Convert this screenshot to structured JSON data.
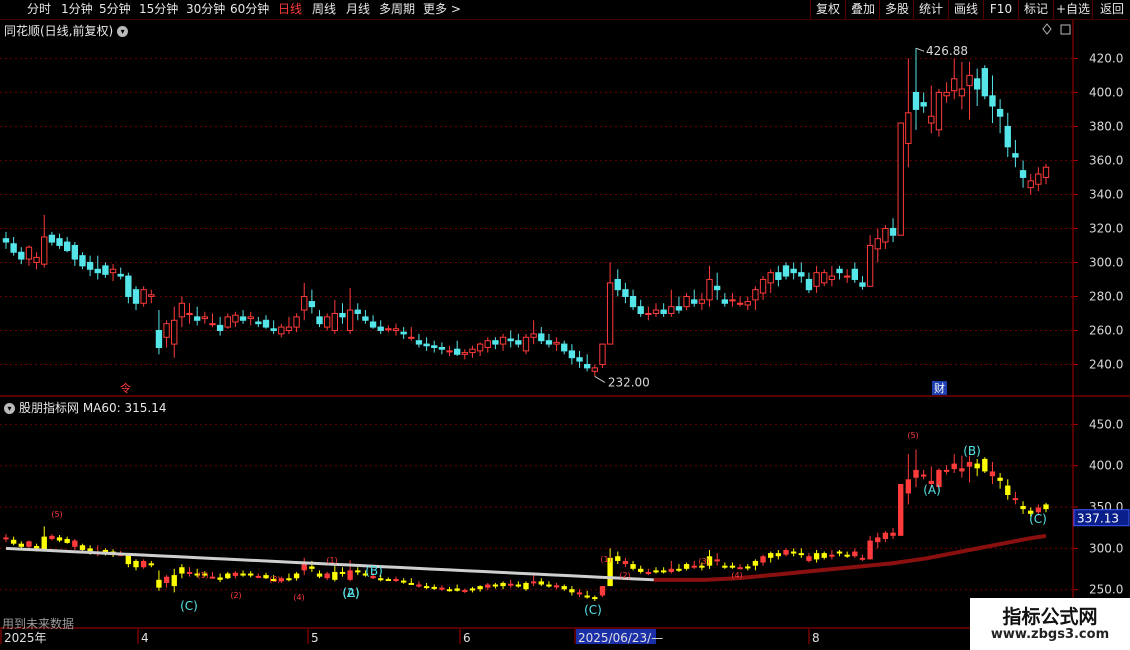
{
  "toolbar": {
    "periods": [
      "分时",
      "1分钟",
      "5分钟",
      "15分钟",
      "30分钟",
      "60分钟",
      "日线",
      "周线",
      "月线",
      "多周期",
      "更多 >"
    ],
    "active_period": "日线",
    "right_buttons": [
      "复权",
      "叠加",
      "多股",
      "统计",
      "画线",
      "F10",
      "标记",
      "+自选",
      "返回"
    ]
  },
  "main_panel": {
    "title": "同花顺(日线,前复权)",
    "high_label": "426.88",
    "low_label": "232.00",
    "marker_left": "令",
    "marker_right": "财"
  },
  "sub_panel": {
    "title": "股朋指标网 MA60: 315.14",
    "price_box": "337.13"
  },
  "future_note": "用到未来数据",
  "watermark": {
    "title": "指标公式网",
    "url": "www.zbgs3.com"
  },
  "colors": {
    "up": "#ff3b3b",
    "down": "#55e6ea",
    "yellow": "#ffff00",
    "grid": "#6b0000",
    "axis": "#b00000"
  },
  "chart_data": [
    {
      "type": "candlestick",
      "name": "main",
      "ylim": [
        225,
        432
      ],
      "yticks": [
        240,
        260,
        280,
        300,
        320,
        340,
        360,
        380,
        400,
        420
      ],
      "xlabels": [],
      "candles": [
        [
          314,
          318,
          308,
          312
        ],
        [
          311,
          315,
          304,
          306
        ],
        [
          306,
          309,
          299,
          302
        ],
        [
          302,
          310,
          298,
          309
        ],
        [
          300,
          306,
          296,
          303
        ],
        [
          299,
          328,
          297,
          315
        ],
        [
          316,
          318,
          310,
          312
        ],
        [
          314,
          317,
          308,
          310
        ],
        [
          312,
          315,
          306,
          307
        ],
        [
          310,
          312,
          298,
          302
        ],
        [
          304,
          306,
          296,
          298
        ],
        [
          300,
          304,
          292,
          296
        ],
        [
          296,
          304,
          290,
          294
        ],
        [
          298,
          300,
          291,
          293
        ],
        [
          294,
          299,
          289,
          296
        ],
        [
          293,
          297,
          290,
          292
        ],
        [
          292,
          294,
          276,
          280
        ],
        [
          284,
          286,
          272,
          276
        ],
        [
          276,
          286,
          274,
          284
        ],
        [
          280,
          284,
          276,
          281
        ],
        [
          260,
          272,
          246,
          250
        ],
        [
          256,
          266,
          250,
          264
        ],
        [
          252,
          274,
          244,
          266
        ],
        [
          268,
          280,
          262,
          276
        ],
        [
          270,
          276,
          264,
          270
        ],
        [
          268,
          274,
          263,
          266
        ],
        [
          267,
          271,
          264,
          268
        ],
        [
          264,
          270,
          262,
          264
        ],
        [
          263,
          268,
          257,
          260
        ],
        [
          262,
          270,
          261,
          268
        ],
        [
          265,
          271,
          262,
          269
        ],
        [
          268,
          272,
          264,
          266
        ],
        [
          267,
          271,
          263,
          268
        ],
        [
          265,
          268,
          262,
          264
        ],
        [
          266,
          269,
          261,
          262
        ],
        [
          261,
          266,
          258,
          260
        ],
        [
          258,
          264,
          256,
          262
        ],
        [
          260,
          268,
          258,
          262
        ],
        [
          262,
          270,
          259,
          268
        ],
        [
          272,
          288,
          266,
          280
        ],
        [
          277,
          284,
          270,
          274
        ],
        [
          268,
          272,
          262,
          264
        ],
        [
          262,
          270,
          260,
          268
        ],
        [
          260,
          278,
          258,
          270
        ],
        [
          270,
          276,
          264,
          268
        ],
        [
          260,
          285,
          258,
          272
        ],
        [
          272,
          276,
          266,
          270
        ],
        [
          268,
          272,
          264,
          266
        ],
        [
          265,
          269,
          261,
          262
        ],
        [
          262,
          266,
          258,
          260
        ],
        [
          261,
          263,
          259,
          261
        ],
        [
          260,
          264,
          257,
          261
        ],
        [
          259,
          262,
          255,
          258
        ],
        [
          256,
          262,
          254,
          256
        ],
        [
          254,
          258,
          250,
          252
        ],
        [
          252,
          256,
          248,
          251
        ],
        [
          251,
          254,
          247,
          250
        ],
        [
          250,
          253,
          246,
          249
        ],
        [
          248,
          251,
          245,
          248
        ],
        [
          249,
          254,
          245,
          246
        ],
        [
          246,
          249,
          243,
          247
        ],
        [
          247,
          251,
          244,
          249
        ],
        [
          248,
          253,
          245,
          252
        ],
        [
          250,
          256,
          247,
          254
        ],
        [
          254,
          256,
          249,
          252
        ],
        [
          252,
          258,
          248,
          256
        ],
        [
          255,
          260,
          250,
          254
        ],
        [
          254,
          258,
          250,
          252
        ],
        [
          248,
          258,
          246,
          256
        ],
        [
          256,
          266,
          252,
          258
        ],
        [
          258,
          262,
          252,
          254
        ],
        [
          254,
          258,
          250,
          252
        ],
        [
          252,
          256,
          248,
          253
        ],
        [
          252,
          254,
          246,
          248
        ],
        [
          248,
          252,
          240,
          244
        ],
        [
          244,
          248,
          238,
          242
        ],
        [
          240,
          246,
          236,
          238
        ],
        [
          236,
          240,
          233,
          238
        ],
        [
          240,
          252,
          238,
          252
        ],
        [
          252,
          300,
          252,
          288
        ],
        [
          290,
          296,
          280,
          284
        ],
        [
          284,
          288,
          276,
          280
        ],
        [
          280,
          284,
          272,
          274
        ],
        [
          274,
          278,
          268,
          270
        ],
        [
          270,
          274,
          266,
          270
        ],
        [
          270,
          276,
          268,
          272
        ],
        [
          272,
          276,
          268,
          270
        ],
        [
          270,
          284,
          268,
          274
        ],
        [
          274,
          280,
          270,
          272
        ],
        [
          274,
          282,
          272,
          280
        ],
        [
          278,
          284,
          274,
          276
        ],
        [
          276,
          282,
          272,
          278
        ],
        [
          278,
          298,
          274,
          290
        ],
        [
          286,
          294,
          278,
          284
        ],
        [
          278,
          282,
          274,
          276
        ],
        [
          278,
          282,
          274,
          278
        ],
        [
          276,
          280,
          274,
          276
        ],
        [
          275,
          280,
          272,
          277
        ],
        [
          278,
          286,
          272,
          284
        ],
        [
          282,
          292,
          278,
          290
        ],
        [
          288,
          296,
          282,
          294
        ],
        [
          294,
          298,
          286,
          290
        ],
        [
          298,
          300,
          290,
          292
        ],
        [
          296,
          300,
          290,
          294
        ],
        [
          294,
          300,
          288,
          292
        ],
        [
          290,
          294,
          282,
          284
        ],
        [
          286,
          298,
          282,
          294
        ],
        [
          288,
          296,
          286,
          294
        ],
        [
          290,
          298,
          286,
          292
        ],
        [
          296,
          298,
          290,
          294
        ],
        [
          292,
          296,
          288,
          292
        ],
        [
          296,
          300,
          288,
          290
        ],
        [
          288,
          292,
          284,
          286
        ],
        [
          286,
          316,
          286,
          310
        ],
        [
          308,
          320,
          300,
          314
        ],
        [
          312,
          322,
          308,
          320
        ],
        [
          320,
          326,
          312,
          316
        ],
        [
          316,
          350,
          316,
          382
        ],
        [
          370,
          420,
          356,
          388
        ],
        [
          400,
          426,
          378,
          390
        ],
        [
          394,
          400,
          388,
          392
        ],
        [
          382,
          404,
          376,
          386
        ],
        [
          378,
          402,
          374,
          400
        ],
        [
          398,
          406,
          394,
          400
        ],
        [
          401,
          420,
          396,
          408
        ],
        [
          398,
          418,
          390,
          402
        ],
        [
          404,
          418,
          384,
          410
        ],
        [
          408,
          414,
          392,
          402
        ],
        [
          414,
          416,
          396,
          398
        ],
        [
          398,
          410,
          382,
          392
        ],
        [
          390,
          396,
          376,
          386
        ],
        [
          380,
          388,
          362,
          368
        ],
        [
          364,
          372,
          356,
          362
        ],
        [
          354,
          360,
          344,
          350
        ],
        [
          344,
          352,
          340,
          348
        ],
        [
          346,
          356,
          342,
          352
        ],
        [
          350,
          358,
          346,
          356
        ]
      ]
    },
    {
      "type": "candlestick",
      "name": "sub",
      "ylim": [
        240,
        465
      ],
      "yticks": [
        250,
        300,
        350,
        400,
        450
      ],
      "xlabels": [
        "2025年",
        "4",
        "5",
        "6",
        "2025/06/23/—",
        "8"
      ],
      "candle_labels": [
        "(5)",
        "(1)",
        "(2)",
        "(3)",
        "(4)",
        "(1)",
        "(2)",
        "(C)",
        "(A)",
        "(B)",
        "(C)",
        "(1)",
        "(2)",
        "(3)",
        "(4)",
        "(5)",
        "(A)",
        "(B)",
        "(C)"
      ],
      "ma60": [
        300,
        299,
        298,
        297,
        296,
        295,
        294,
        293,
        292,
        291,
        290,
        289,
        288,
        287,
        286,
        285,
        284,
        283,
        282,
        281,
        280,
        279,
        278,
        277,
        276,
        275,
        274,
        273,
        272,
        271,
        270,
        269,
        268,
        267,
        266,
        265,
        264,
        263,
        262,
        262,
        262,
        262,
        263,
        264,
        266,
        268,
        270,
        272,
        274,
        276,
        278,
        280,
        282,
        285,
        288,
        292,
        296,
        300,
        304,
        308,
        312,
        315.14
      ],
      "price_box": 337.13
    }
  ]
}
